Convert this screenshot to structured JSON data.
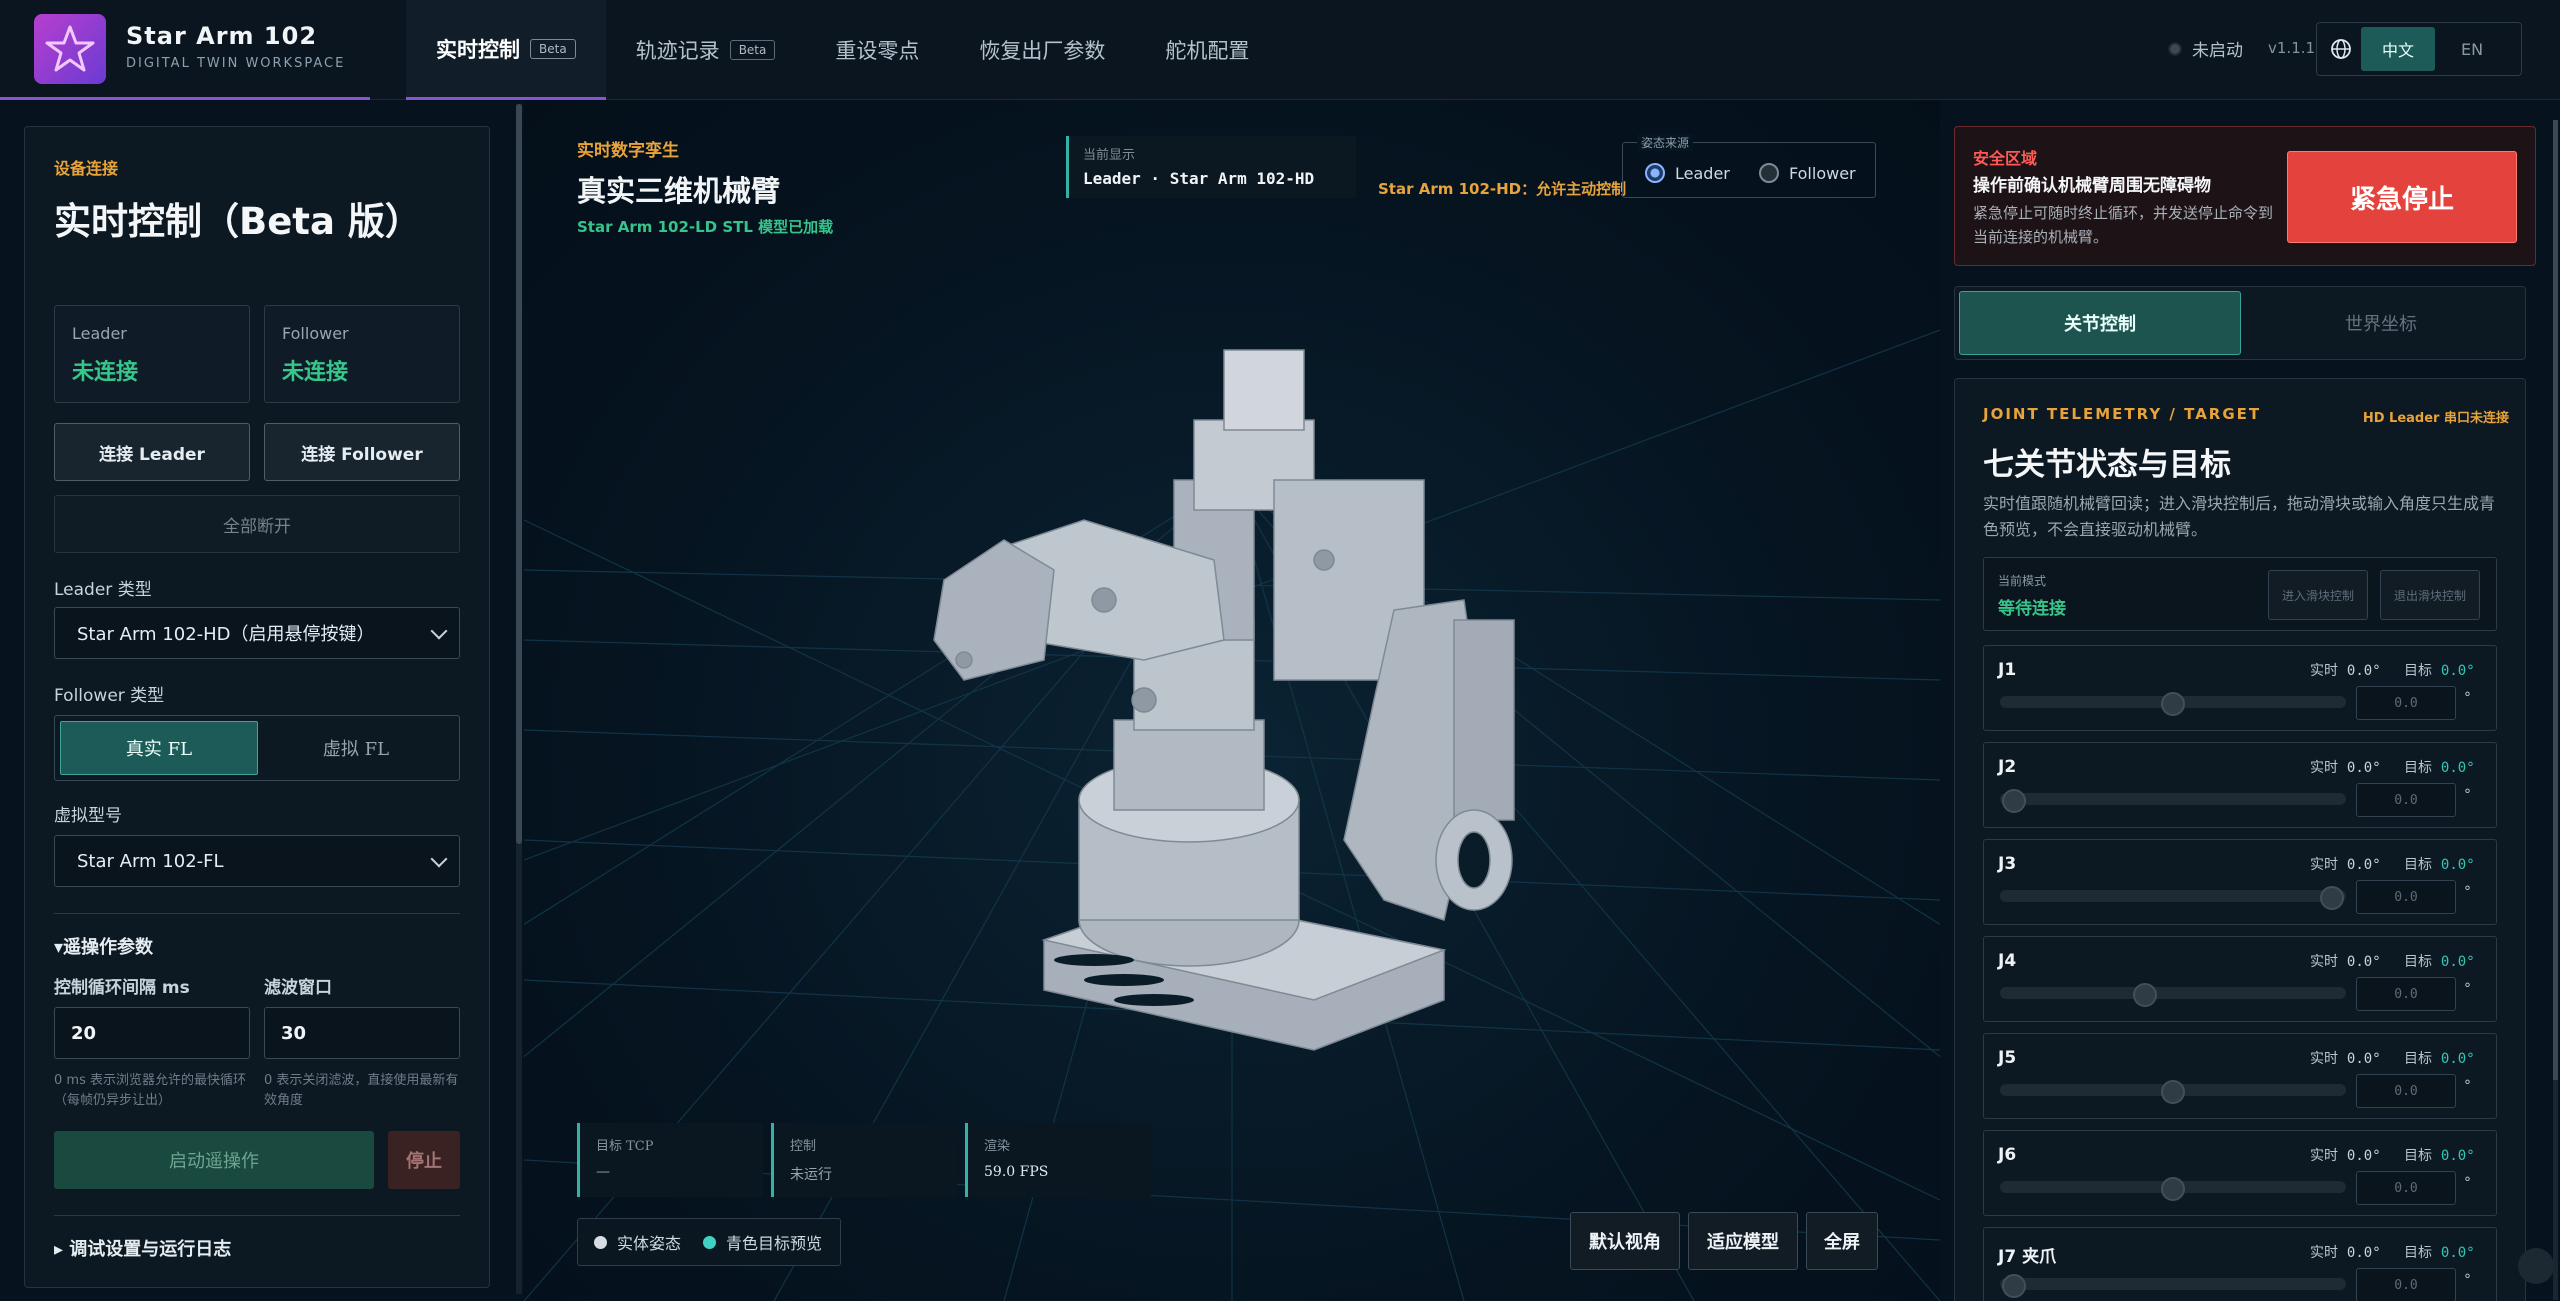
{
  "header": {
    "app_title": "Star Arm 102",
    "app_subtitle": "DIGITAL TWIN WORKSPACE",
    "tabs": [
      {
        "label": "实时控制",
        "badge": "Beta",
        "active": true
      },
      {
        "label": "轨迹记录",
        "badge": "Beta",
        "active": false
      },
      {
        "label": "重设零点",
        "badge": "",
        "active": false
      },
      {
        "label": "恢复出厂参数",
        "badge": "",
        "active": false
      },
      {
        "label": "舵机配置",
        "badge": "",
        "active": false
      }
    ],
    "status": "未启动",
    "version": "v1.1.1",
    "lang": {
      "zh": "中文",
      "en": "EN"
    }
  },
  "left": {
    "eyebrow": "设备连接",
    "title": "实时控制（Beta 版）",
    "leader_label": "Leader",
    "leader_status": "未连接",
    "follower_label": "Follower",
    "follower_status": "未连接",
    "connect_leader": "连接 Leader",
    "connect_follower": "连接 Follower",
    "disconnect_all": "全部断开",
    "leader_type_label": "Leader 类型",
    "leader_type_value": "Star Arm 102-HD（启用悬停按键）",
    "follower_type_label": "Follower 类型",
    "follower_real": "真实 FL",
    "follower_virtual": "虚拟 FL",
    "virtual_model_label": "虚拟型号",
    "virtual_model_value": "Star Arm 102-FL",
    "teleop_section": "▾遥操作参数",
    "loop_interval_label": "控制循环间隔 ms",
    "loop_interval_value": "20",
    "loop_interval_hint": "0 ms 表示浏览器允许的最快循环（每帧仍异步让出）",
    "filter_label": "滤波窗口",
    "filter_value": "30",
    "filter_hint": "0 表示关闭滤波，直接使用最新有效角度",
    "start_teleop": "启动遥操作",
    "stop": "停止",
    "debug_section": "▸ 调试设置与运行日志"
  },
  "viewport": {
    "eyebrow": "实时数字孪生",
    "title": "真实三维机械臂",
    "subtitle": "Star Arm 102-LD STL 模型已加载",
    "current_display_label": "当前显示",
    "current_display_value": "Leader · Star Arm 102-HD",
    "notice": "Star Arm 102-HD：允许主动控制",
    "pose_source_label": "姿态来源",
    "pose_leader": "Leader",
    "pose_follower": "Follower",
    "metrics": [
      {
        "label": "目标 TCP",
        "value": "—"
      },
      {
        "label": "控制",
        "value": "未运行"
      },
      {
        "label": "渲染",
        "value": "59.0 FPS"
      }
    ],
    "legend_solid": "实体姿态",
    "legend_cyan": "青色目标预览",
    "btn_default_view": "默认视角",
    "btn_fit_model": "适应模型",
    "btn_fullscreen": "全屏"
  },
  "right": {
    "safety_eyebrow": "安全区域",
    "safety_title": "操作前确认机械臂周围无障碍物",
    "safety_desc": "紧急停止可随时终止循环，并发送停止命令到当前连接的机械臂。",
    "estop": "紧急停止",
    "tab_joint": "关节控制",
    "tab_world": "世界坐标",
    "panel_eyebrow": "JOINT TELEMETRY / TARGET",
    "panel_warn": "HD Leader 串口未连接",
    "panel_title": "七关节状态与目标",
    "panel_desc": "实时值跟随机械臂回读；进入滑块控制后，拖动滑块或输入角度只生成青色预览，不会直接驱动机械臂。",
    "mode_label": "当前模式",
    "mode_value": "等待连接",
    "enter_slider": "进入滑块控制",
    "exit_slider": "退出滑块控制",
    "real_label": "实时",
    "target_label": "目标",
    "deg_unit": "°",
    "joints": [
      {
        "name": "J1",
        "real": "0.0°",
        "target": "0.0°",
        "input": "0.0",
        "pos": 0.5
      },
      {
        "name": "J2",
        "real": "0.0°",
        "target": "0.0°",
        "input": "0.0",
        "pos": 0.04
      },
      {
        "name": "J3",
        "real": "0.0°",
        "target": "0.0°",
        "input": "0.0",
        "pos": 0.96
      },
      {
        "name": "J4",
        "real": "0.0°",
        "target": "0.0°",
        "input": "0.0",
        "pos": 0.42
      },
      {
        "name": "J5",
        "real": "0.0°",
        "target": "0.0°",
        "input": "0.0",
        "pos": 0.5
      },
      {
        "name": "J6",
        "real": "0.0°",
        "target": "0.0°",
        "input": "0.0",
        "pos": 0.5
      },
      {
        "name": "J7 夹爪",
        "real": "0.0°",
        "target": "0.0°",
        "input": "0.0",
        "pos": 0.04
      }
    ]
  }
}
